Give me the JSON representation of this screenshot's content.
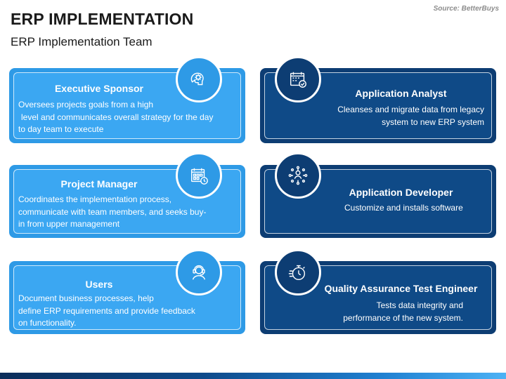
{
  "header": {
    "title": "ERP IMPLEMENTATION",
    "subtitle": "ERP Implementation Team",
    "source": "Source: BetterBuys"
  },
  "roles": [
    {
      "title": "Executive Sponsor",
      "lines": [
        "Oversees projects goals from a high",
        "level and communicates overall strategy for the day",
        "to day team to execute"
      ],
      "icon": "brain-gear-icon"
    },
    {
      "title": "Project Manager",
      "lines": [
        "Coordinates the implementation process,",
        "communicate with team members, and seeks buy-",
        "in from upper management"
      ],
      "icon": "calendar-clock-icon"
    },
    {
      "title": "Users",
      "lines": [
        "Document business processes, help",
        "define ERP requirements and provide feedback",
        "on functionality."
      ],
      "icon": "headset-user-icon"
    },
    {
      "title": "Application Analyst",
      "lines": [
        "Cleanses and migrate data from legacy",
        "system to new ERP system"
      ],
      "icon": "calendar-check-icon"
    },
    {
      "title": "Application Developer",
      "lines": [
        "Customize and installs software"
      ],
      "icon": "network-person-icon"
    },
    {
      "title": "Quality Assurance Test Engineer",
      "lines": [
        "Tests data integrity and",
        "performance of the new system."
      ],
      "icon": "stopwatch-icon"
    }
  ],
  "colors": {
    "light_card": "#3ba7f2",
    "dark_card": "#0f4a87",
    "title_text": "#1a1a1a",
    "source_text": "#8c8c8c"
  }
}
